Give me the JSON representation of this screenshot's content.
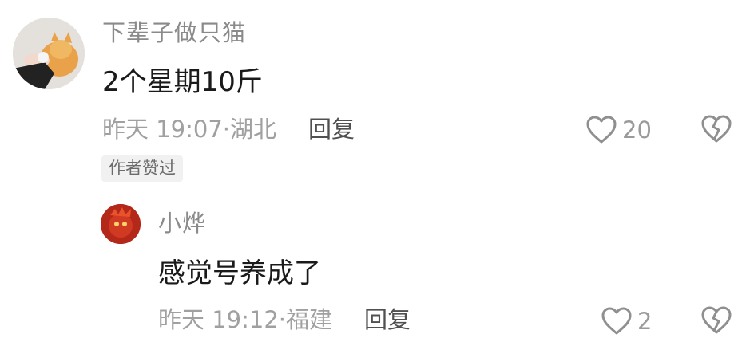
{
  "comment": {
    "username": "下辈子做只猫",
    "text": "2个星期10斤",
    "time": "昨天 19:07",
    "location": "湖北",
    "reply_label": "回复",
    "likes": "20",
    "badge": "作者赞过"
  },
  "reply": {
    "username": "小烨",
    "text": "感觉号养成了",
    "time": "昨天 19:12",
    "location": "福建",
    "reply_label": "回复",
    "likes": "2"
  },
  "icons": {
    "like": "heart-outline-icon",
    "dislike": "broken-heart-outline-icon"
  },
  "colors": {
    "meta": "#a0a0a0",
    "username": "#8a8a8a",
    "text": "#1a1a1a"
  }
}
